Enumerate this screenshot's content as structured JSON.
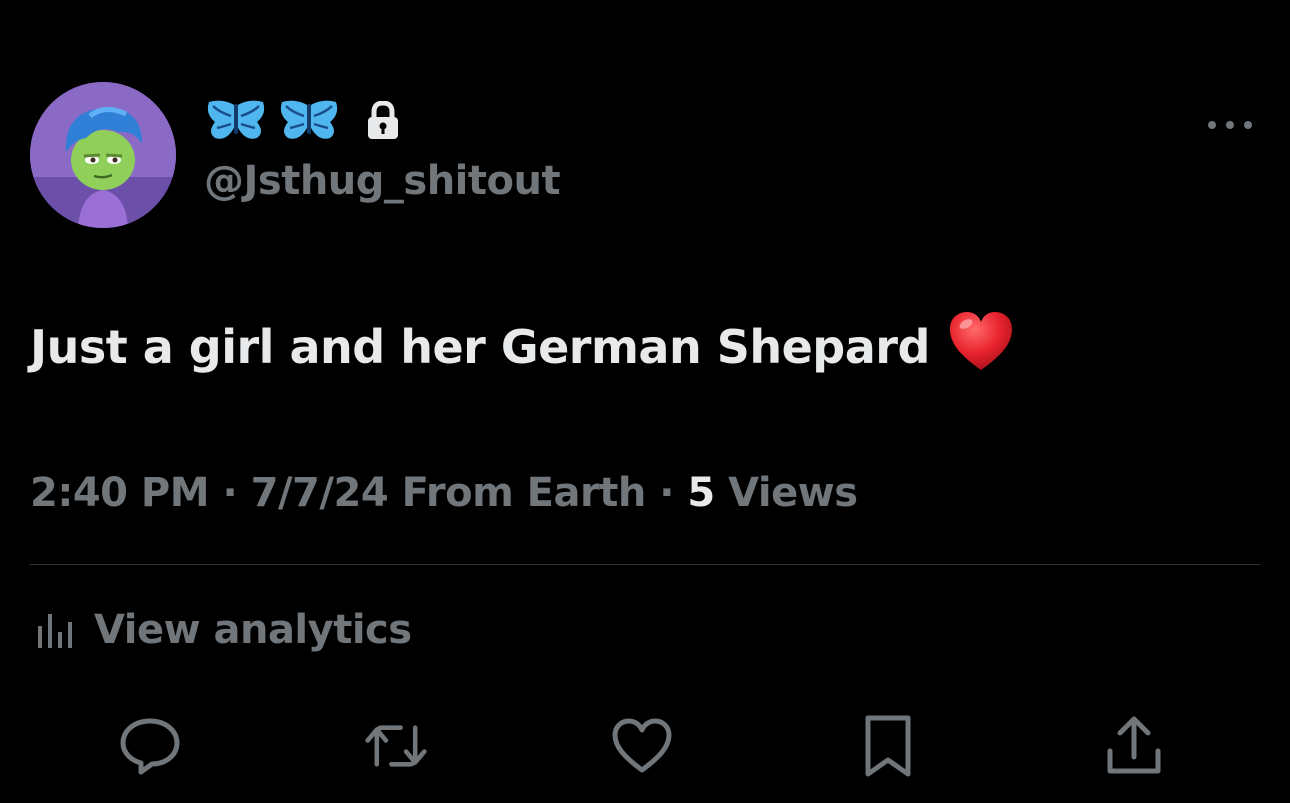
{
  "user": {
    "display_name": "🦋🦋",
    "handle": "@Jsthug_shitout",
    "avatar_icon": "inside-out-character-avatar",
    "protected_icon": "lock-icon"
  },
  "tweet": {
    "text": "Just a girl and her German Shepard",
    "emoji": "heart-emoji",
    "time": "2:40 PM",
    "date": "7/7/24",
    "source": "From Earth",
    "views_count": "5",
    "views_label": "Views"
  },
  "analytics": {
    "label": "View analytics"
  },
  "actions": {
    "reply": "reply-icon",
    "retweet": "retweet-icon",
    "like": "like-icon",
    "bookmark": "bookmark-icon",
    "share": "share-icon"
  },
  "colors": {
    "background": "#000000",
    "primary_text": "#e7e9ea",
    "secondary_text": "#71767b",
    "divider": "#2f3336",
    "heart": "#e8232e",
    "butterfly": "#4fb6f0"
  }
}
